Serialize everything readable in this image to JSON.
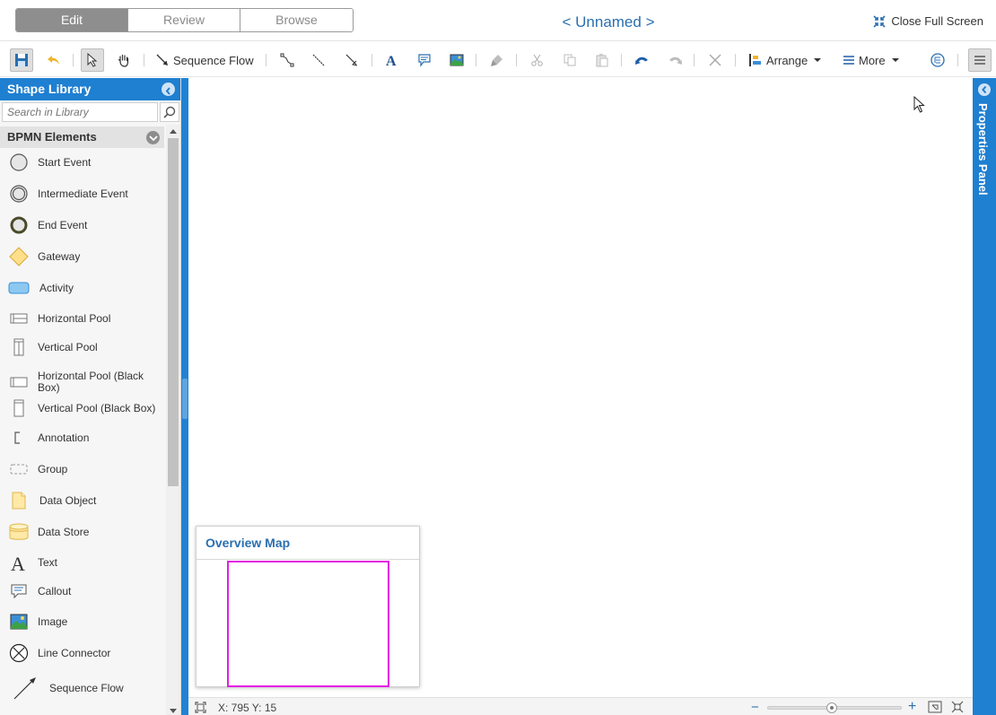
{
  "header": {
    "tabs": [
      {
        "label": "Edit",
        "active": true
      },
      {
        "label": "Review",
        "active": false
      },
      {
        "label": "Browse",
        "active": false
      }
    ],
    "title": "< Unnamed >",
    "close_fullscreen": "Close Full Screen"
  },
  "toolbar": {
    "sequence_flow": "Sequence Flow",
    "arrange": "Arrange",
    "more": "More",
    "icons": [
      "save-icon",
      "undo-back-icon",
      "select-pointer-icon",
      "pan-hand-icon",
      "sequence-flow-icon",
      "connector-icon",
      "line-icon",
      "directed-line-icon",
      "text-icon",
      "callout-icon",
      "image-icon",
      "format-painter-icon",
      "cut-icon",
      "copy-icon",
      "paste-icon",
      "undo-icon",
      "redo-icon",
      "delete-icon",
      "arrange-icon",
      "more-icon",
      "outline-icon",
      "menu-icon"
    ]
  },
  "library": {
    "title": "Shape Library",
    "search_placeholder": "Search in Library",
    "section": "BPMN Elements",
    "items": [
      {
        "label": "Start Event",
        "icon": "start-event-icon"
      },
      {
        "label": "Intermediate Event",
        "icon": "intermediate-event-icon"
      },
      {
        "label": "End Event",
        "icon": "end-event-icon"
      },
      {
        "label": "Gateway",
        "icon": "gateway-icon"
      },
      {
        "label": "Activity",
        "icon": "activity-icon"
      },
      {
        "label": "Horizontal Pool",
        "icon": "horizontal-pool-icon"
      },
      {
        "label": "Vertical Pool",
        "icon": "vertical-pool-icon"
      },
      {
        "label": "Horizontal Pool (Black Box)",
        "icon": "horizontal-pool-black-box-icon"
      },
      {
        "label": "Vertical Pool (Black Box)",
        "icon": "vertical-pool-black-box-icon"
      },
      {
        "label": "Annotation",
        "icon": "annotation-icon"
      },
      {
        "label": "Group",
        "icon": "group-icon"
      },
      {
        "label": "Data Object",
        "icon": "data-object-icon"
      },
      {
        "label": "Data Store",
        "icon": "data-store-icon"
      },
      {
        "label": "Text",
        "icon": "text-icon"
      },
      {
        "label": "Callout",
        "icon": "callout-icon"
      },
      {
        "label": "Image",
        "icon": "image-icon"
      },
      {
        "label": "Line Connector",
        "icon": "line-connector-icon"
      },
      {
        "label": "Sequence Flow",
        "icon": "sequence-flow-icon"
      }
    ]
  },
  "overview": {
    "title": "Overview Map"
  },
  "properties_panel": {
    "label": "Properties Panel"
  },
  "status": {
    "coords": "X: 795 Y: 15",
    "zoom_level": 0.48
  },
  "colors": {
    "accent": "#1f7fd1",
    "title": "#2a6fb0",
    "viewport": "#e21ee2"
  }
}
